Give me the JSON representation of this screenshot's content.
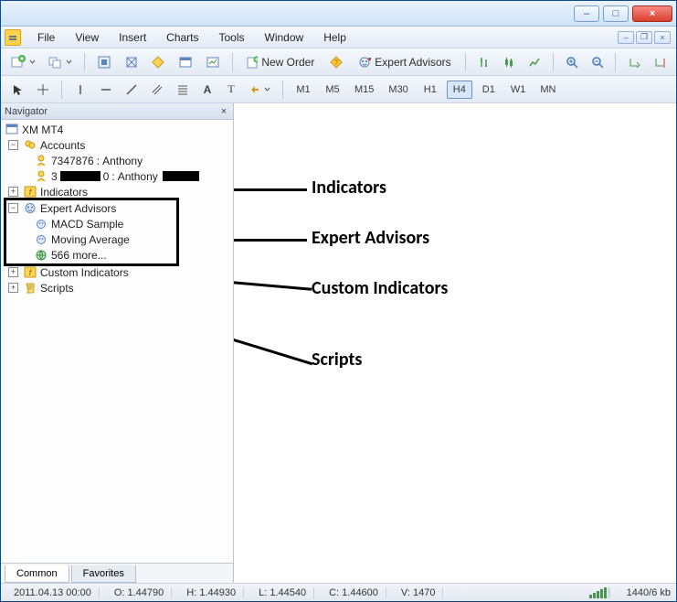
{
  "window": {
    "min_glyph": "–",
    "max_glyph": "□",
    "close_glyph": "×"
  },
  "mdi": {
    "min": "–",
    "restore": "❐",
    "close": "×"
  },
  "menu": {
    "items": [
      "File",
      "View",
      "Insert",
      "Charts",
      "Tools",
      "Window",
      "Help"
    ]
  },
  "toolbar1": {
    "new_order": "New Order",
    "expert_advisors": "Expert Advisors"
  },
  "toolbar2": {
    "letter_a": "A",
    "letter_t": "T",
    "timeframes": [
      "M1",
      "M5",
      "M15",
      "M30",
      "H1",
      "H4",
      "D1",
      "W1",
      "MN"
    ],
    "active_tf": "H4"
  },
  "navigator": {
    "title": "Navigator",
    "root": "XM MT4",
    "accounts_label": "Accounts",
    "accounts": [
      {
        "id": "7347876",
        "name": "Anthony"
      },
      {
        "id_visible": "3",
        "id_redacted": "0",
        "name": "Anthony"
      }
    ],
    "indicators_label": "Indicators",
    "ea_label": "Expert Advisors",
    "ea_items": [
      "MACD Sample",
      "Moving Average",
      "566 more..."
    ],
    "custom_ind_label": "Custom Indicators",
    "scripts_label": "Scripts",
    "tabs": {
      "common": "Common",
      "favorites": "Favorites"
    }
  },
  "annotations": {
    "indicators": "Indicators",
    "ea": "Expert Advisors",
    "custom": "Custom Indicators",
    "scripts": "Scripts"
  },
  "status": {
    "datetime": "2011.04.13 00:00",
    "open": "O: 1.44790",
    "high": "H: 1.44930",
    "low": "L: 1.44540",
    "close": "C: 1.44600",
    "vol": "V: 1470",
    "kb": "1440/6 kb"
  }
}
